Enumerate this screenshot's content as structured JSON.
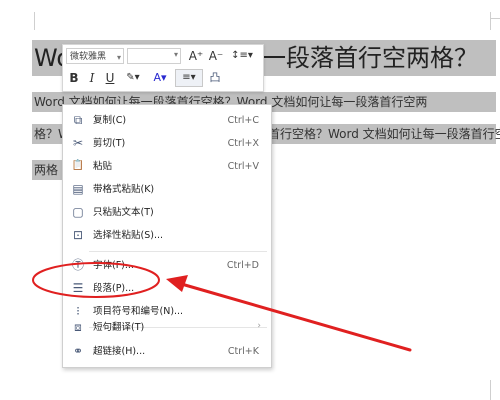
{
  "document": {
    "title_start": "Wo",
    "title_end": "一段落首行空两格？",
    "paragraph_lines": [
      "Word 文档如何让每一段落首行空格？Word 文档如何让每一段落首行空两",
      "格？W",
      "落首行空格？Word 文档如何让每一段落首行空",
      "两格"
    ]
  },
  "mini_toolbar": {
    "font_name": "微软雅黑",
    "font_dropdown": "▾",
    "size_dropdown": "▾",
    "grow_font": "A⁺",
    "shrink_font": "A⁻",
    "line_spacing": "↕≡▾",
    "bold": "B",
    "italic": "I",
    "underline": "U",
    "highlight": "✎▾",
    "font_color": "A▾",
    "align": "≡▾",
    "format_painter": "凸"
  },
  "context_menu": {
    "items": [
      {
        "icon": "copy-icon",
        "glyph": "⧉",
        "label": "复制(C)",
        "shortcut": "Ctrl+C"
      },
      {
        "icon": "scissors-icon",
        "glyph": "✂",
        "label": "剪切(T)",
        "shortcut": "Ctrl+X"
      },
      {
        "icon": "paste-icon",
        "glyph": "📋",
        "label": "粘贴",
        "shortcut": "Ctrl+V"
      },
      {
        "icon": "paste-format-icon",
        "glyph": "▤",
        "label": "带格式粘贴(K)",
        "shortcut": ""
      },
      {
        "icon": "paste-text-icon",
        "glyph": "▢",
        "label": "只粘贴文本(T)",
        "shortcut": ""
      },
      {
        "icon": "paste-special-icon",
        "glyph": "⊡",
        "label": "选择性粘贴(S)...",
        "shortcut": ""
      },
      {
        "icon": "font-icon",
        "glyph": "Ⓣ",
        "label": "字体(F)...",
        "shortcut": "Ctrl+D"
      },
      {
        "icon": "paragraph-icon",
        "glyph": "☰",
        "label": "段落(P)...",
        "shortcut": ""
      },
      {
        "icon": "bullets-icon",
        "glyph": "⁝",
        "label": "项目符号和编号(N)...",
        "shortcut": ""
      },
      {
        "icon": "translate-icon",
        "glyph": "⧈",
        "label": "短句翻译(T)",
        "shortcut": "›"
      },
      {
        "icon": "hyperlink-icon",
        "glyph": "⚭",
        "label": "超链接(H)...",
        "shortcut": "Ctrl+K"
      }
    ]
  },
  "colors": {
    "selection": "#bfbfbf",
    "annotation": "#e02020",
    "icon": "#4a5a78"
  }
}
